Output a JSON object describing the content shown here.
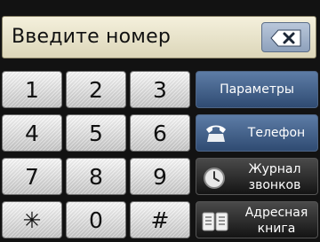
{
  "entry": {
    "placeholder_text": "Введите номер"
  },
  "keypad": {
    "keys": [
      "1",
      "2",
      "3",
      "4",
      "5",
      "6",
      "7",
      "8",
      "9",
      "✳",
      "0",
      "#"
    ]
  },
  "buttons": {
    "options": "Параметры",
    "phone": "Телефон",
    "call_history": "Журнал\nзвонков",
    "address_book": "Адресная\nкнига"
  },
  "colors": {
    "field_bg": "#e8e3c8",
    "function_button": "#3f5f8a",
    "dark_button": "#2a2a2a",
    "key_bg": "#e6e6e6"
  },
  "icons": [
    "backspace-icon",
    "phone-handset-icon",
    "clock-icon",
    "address-book-icon"
  ]
}
